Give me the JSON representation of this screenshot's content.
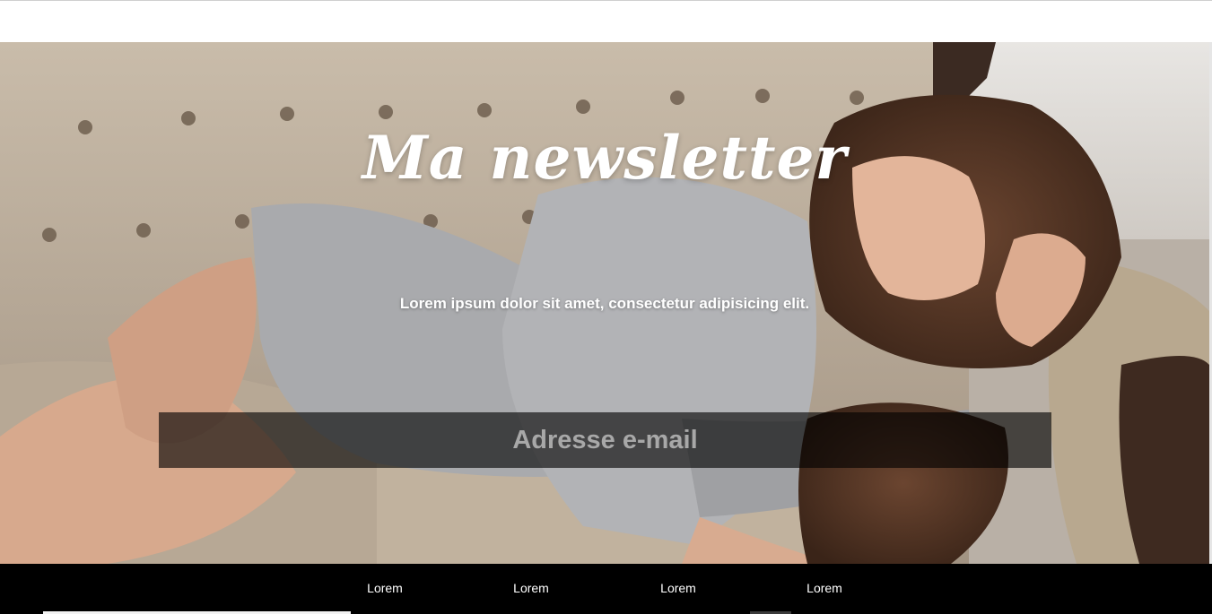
{
  "hero": {
    "title": "Ma newsletter",
    "subtitle": "Lorem ipsum dolor sit amet, consectetur adipisicing elit.",
    "email_placeholder": "Adresse e-mail",
    "image": "woman-on-tufted-sofa-photo"
  },
  "footer": {
    "links": [
      "Lorem",
      "Lorem",
      "Lorem",
      "Lorem"
    ]
  },
  "colors": {
    "footer_bg": "#000000",
    "text": "#ffffff",
    "input_bg": "rgba(0,0,0,0.62)"
  }
}
